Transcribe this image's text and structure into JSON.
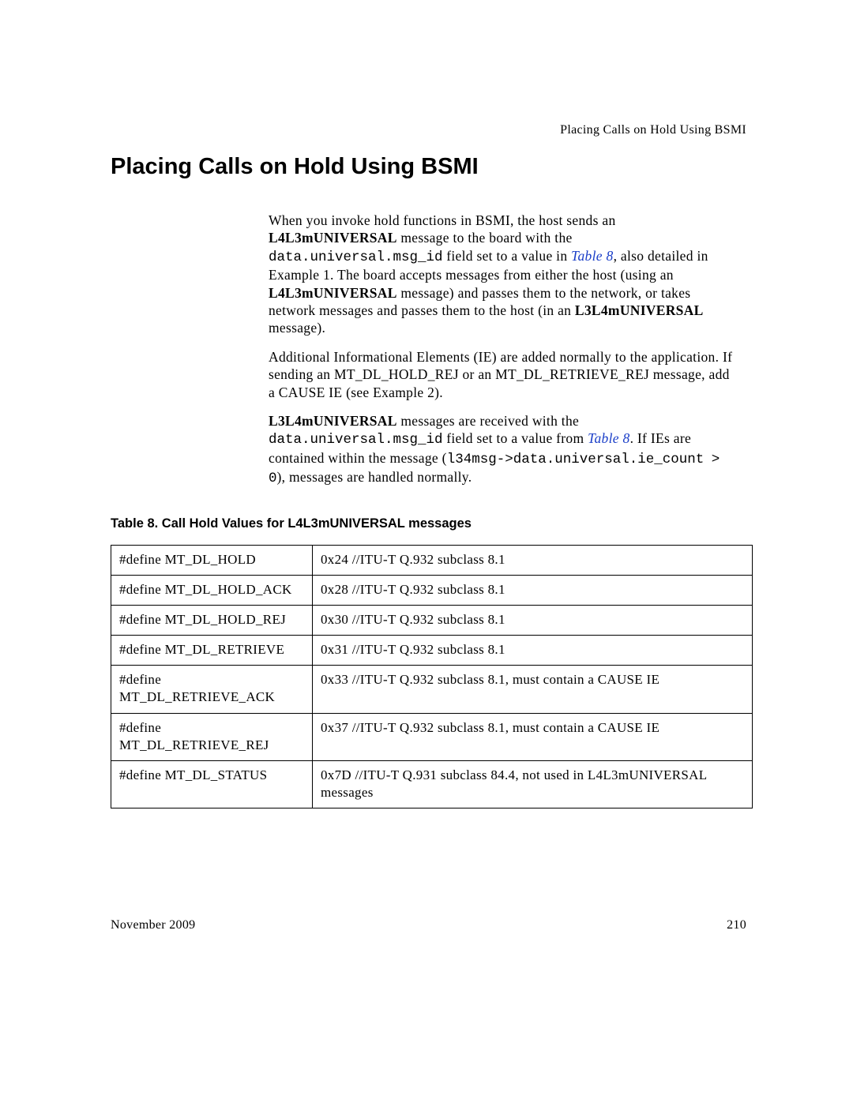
{
  "runningHead": "Placing Calls on Hold Using BSMI",
  "title": "Placing Calls on Hold Using BSMI",
  "para1": {
    "t1": "When you invoke hold functions in BSMI, the host sends an ",
    "b1": "L4L3mUNIVERSAL",
    "t2": " message to the board with the ",
    "code1": "data.universal.msg_id",
    "t3": " field set to a value in ",
    "link1": "Table 8",
    "t4": ", also detailed in Example 1. The board accepts messages from either the host (using an ",
    "b2": "L4L3mUNIVERSAL",
    "t5": " message) and passes them to the network, or takes network messages and passes them to the host (in an ",
    "b3": "L3L4mUNIVERSAL",
    "t6": " message)."
  },
  "para2": "Additional Informational Elements (IE) are added normally to the application. If sending an MT_DL_HOLD_REJ or an MT_DL_RETRIEVE_REJ message, add a CAUSE IE (see Example 2).",
  "para3": {
    "b1": "L3L4mUNIVERSAL",
    "t1": " messages are received with the ",
    "code1": "data.universal.msg_id",
    "t2": " field set to a value from ",
    "link1": "Table 8",
    "t3": ". If IEs are contained within the message (",
    "code2": "l34msg->data.universal.ie_count > 0",
    "t4": "), messages are handled normally."
  },
  "tableCaption": "Table 8.  Call Hold Values for L4L3mUNIVERSAL messages",
  "rows": [
    {
      "c1": "#define MT_DL_HOLD",
      "c2": "0x24 //ITU-T Q.932 subclass 8.1"
    },
    {
      "c1": "#define MT_DL_HOLD_ACK",
      "c2": "0x28 //ITU-T Q.932 subclass 8.1"
    },
    {
      "c1": "#define MT_DL_HOLD_REJ",
      "c2": "0x30 //ITU-T Q.932 subclass 8.1"
    },
    {
      "c1": "#define MT_DL_RETRIEVE",
      "c2": "0x31 //ITU-T Q.932 subclass 8.1"
    },
    {
      "c1": "#define MT_DL_RETRIEVE_ACK",
      "c2": "0x33 //ITU-T Q.932 subclass 8.1, must contain a CAUSE IE"
    },
    {
      "c1": "#define MT_DL_RETRIEVE_REJ",
      "c2": "0x37 //ITU-T Q.932 subclass 8.1, must contain a CAUSE IE"
    },
    {
      "c1": "#define MT_DL_STATUS",
      "c2": "0x7D //ITU-T Q.931 subclass 84.4, not used in L4L3mUNIVERSAL messages"
    }
  ],
  "footerLeft": "November 2009",
  "footerRight": "210"
}
